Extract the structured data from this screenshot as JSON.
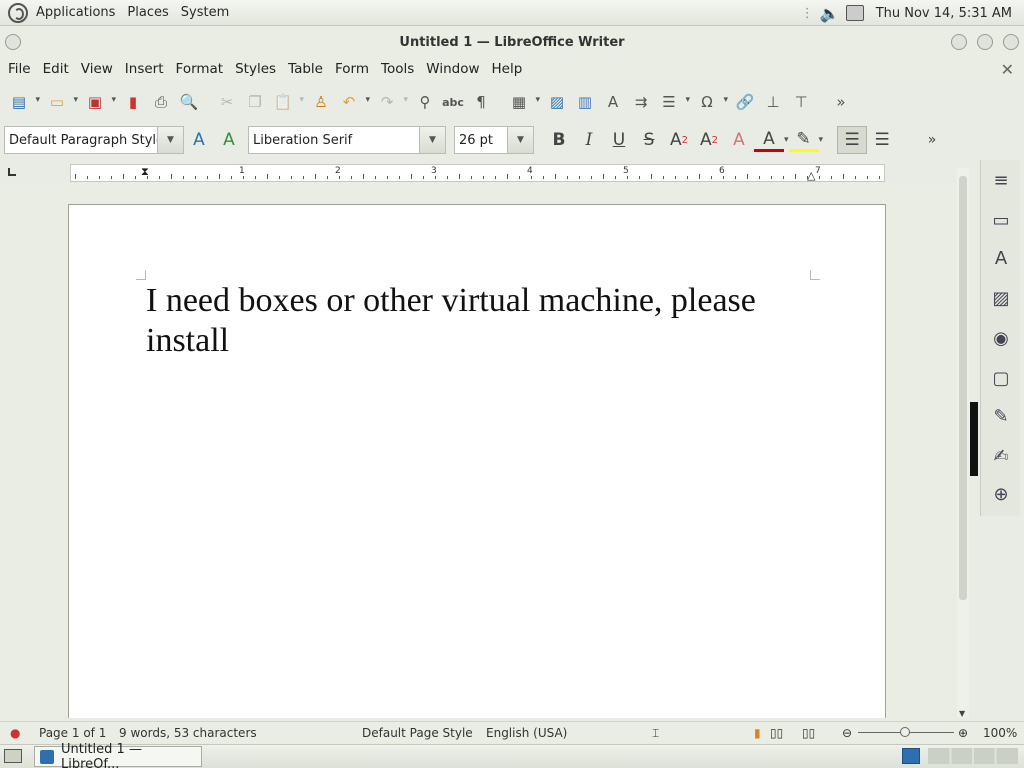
{
  "panel": {
    "applications": "Applications",
    "places": "Places",
    "system": "System",
    "clock": "Thu Nov 14,  5:31 AM"
  },
  "window": {
    "title": "Untitled 1 — LibreOffice Writer"
  },
  "menu": [
    "File",
    "Edit",
    "View",
    "Insert",
    "Format",
    "Styles",
    "Table",
    "Form",
    "Tools",
    "Window",
    "Help"
  ],
  "format_toolbar": {
    "paragraph_style": "Default Paragraph Style",
    "font_name": "Liberation Serif",
    "font_size": "26 pt"
  },
  "ruler": {
    "numbers": [
      "1",
      "2",
      "3",
      "4",
      "5",
      "6",
      "7"
    ]
  },
  "document": {
    "text": "I need boxes or other virtual machine, please install"
  },
  "statusbar": {
    "page": "Page 1 of 1",
    "wordcount": "9 words, 53 characters",
    "page_style": "Default Page Style",
    "language": "English (USA)",
    "zoom": "100%"
  },
  "taskbar": {
    "task_label": "Untitled 1 — LibreOf..."
  },
  "colors": {
    "font_color": "#cc0000",
    "highlight_color": "#ffff00",
    "accent": "#2f6fb0"
  }
}
